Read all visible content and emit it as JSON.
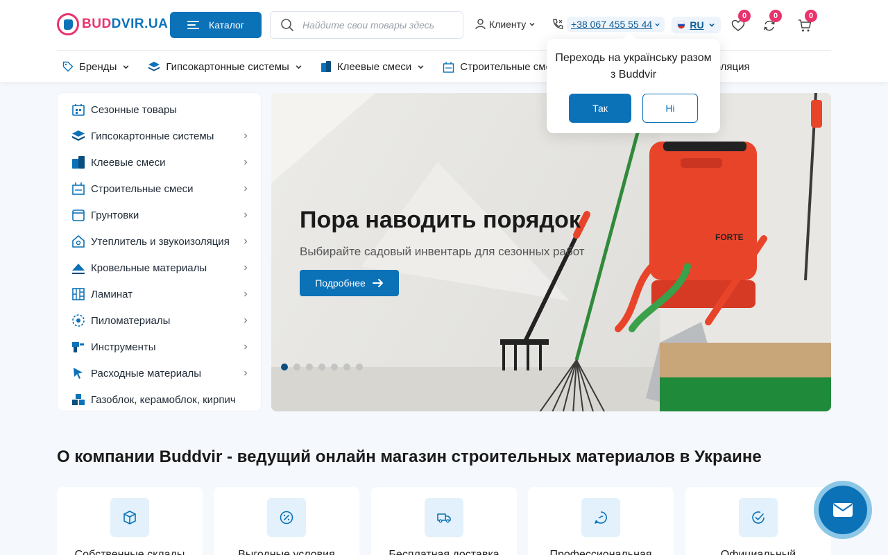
{
  "header": {
    "logo_part1": "BUD",
    "logo_part2": "DVIR.UA",
    "catalog_label": "Каталог",
    "search_placeholder": "Найдите свои товары здесь",
    "client_label": "Клиенту",
    "phone": "+38 067 455 55 44",
    "lang": "RU",
    "wishlist_count": "0",
    "compare_count": "0",
    "cart_count": "0"
  },
  "nav": [
    {
      "label": "Бренды",
      "icon": "tag-icon"
    },
    {
      "label": "Гипсокартонные системы",
      "icon": "layers-icon"
    },
    {
      "label": "Клеевые смеси",
      "icon": "glue-icon"
    },
    {
      "label": "Строительные смеси",
      "icon": "mix-icon"
    },
    {
      "label": "Утеплитель и звукоизоляция",
      "icon": "insulation-icon"
    }
  ],
  "popup": {
    "text": "Переходь на українську разом з Buddvir",
    "yes_label": "Так",
    "no_label": "Ні"
  },
  "sidebar": {
    "items": [
      {
        "label": "Сезонные товары",
        "icon": "season-icon",
        "arrow": false
      },
      {
        "label": "Гипсокартонные системы",
        "icon": "layers-icon",
        "arrow": true
      },
      {
        "label": "Клеевые смеси",
        "icon": "glue-icon",
        "arrow": true
      },
      {
        "label": "Строительные смеси",
        "icon": "mix-icon",
        "arrow": true
      },
      {
        "label": "Грунтовки",
        "icon": "primer-icon",
        "arrow": true
      },
      {
        "label": "Утеплитель и звукоизоляция",
        "icon": "house-icon",
        "arrow": true
      },
      {
        "label": "Кровельные материалы",
        "icon": "roof-icon",
        "arrow": true
      },
      {
        "label": "Ламинат",
        "icon": "laminate-icon",
        "arrow": true
      },
      {
        "label": "Пиломатериалы",
        "icon": "saw-icon",
        "arrow": true
      },
      {
        "label": "Инструменты",
        "icon": "tools-icon",
        "arrow": true
      },
      {
        "label": "Расходные материалы",
        "icon": "cursor-icon",
        "arrow": true
      },
      {
        "label": "Газоблок, керамоблок, кирпич",
        "icon": "blocks-icon",
        "arrow": false
      }
    ]
  },
  "banner": {
    "title": "Пора наводить порядок",
    "subtitle": "Выбирайте садовый инвентарь для сезонных работ",
    "button_label": "Подробнее",
    "brand_text": "FORTE",
    "slide_count": 7,
    "active_slide": 1
  },
  "about": {
    "title": "О компании Buddvir - ведущий онлайн магазин строительных материалов в Украине",
    "features": [
      {
        "label": "Собственные склады",
        "icon": "box-icon"
      },
      {
        "label": "Выгодные условия",
        "icon": "percent-icon"
      },
      {
        "label": "Бесплатная доставка",
        "icon": "truck-icon"
      },
      {
        "label": "Профессиональная",
        "icon": "chat-icon"
      },
      {
        "label": "Официальный",
        "icon": "check-icon"
      }
    ]
  },
  "colors": {
    "primary": "#0b72b8",
    "accent": "#e8336d",
    "background": "#f5f8fc"
  }
}
